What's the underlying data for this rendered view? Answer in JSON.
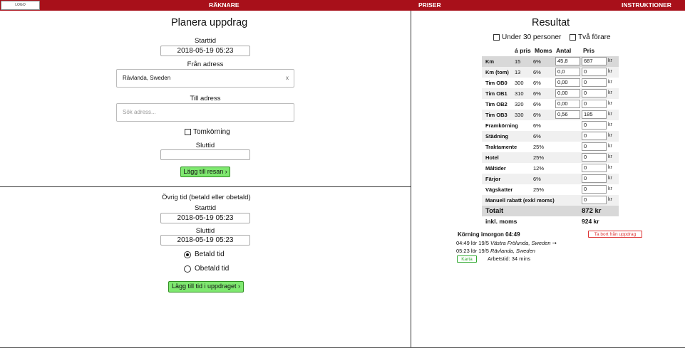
{
  "nav": {
    "logo": "LOGO",
    "raknare": "RÄKNARE",
    "priser": "PRISER",
    "instruktioner": "INSTRUKTIONER"
  },
  "plan": {
    "title": "Planera uppdrag",
    "starttid_label": "Starttid",
    "starttid_value": "2018-05-19 05:23",
    "fran_label": "Från adress",
    "fran_value": "Rävlanda, Sweden",
    "fran_clear": "x",
    "till_label": "Till adress",
    "till_placeholder": "Sök adress...",
    "tomkorning": "Tomkörning",
    "sluttid_label": "Sluttid",
    "sluttid_value": "",
    "add_button": "Lägg till resan ›"
  },
  "ovrig": {
    "title": "Övrig tid (betald eller obetald)",
    "starttid_label": "Starttid",
    "starttid_value": "2018-05-19 05:23",
    "sluttid_label": "Sluttid",
    "sluttid_value": "2018-05-19 05:23",
    "betald": "Betald tid",
    "obetald": "Obetald tid",
    "selected": "betald",
    "add_button": "Lägg till tid i uppdraget ›"
  },
  "result": {
    "title": "Resultat",
    "under30": "Under 30 personer",
    "tva_forare": "Två förare",
    "headers": {
      "apris": "á pris",
      "moms": "Moms",
      "antal": "Antal",
      "pris": "Pris"
    },
    "currency": "kr",
    "rows": [
      {
        "name": "Km",
        "apris": "15",
        "moms": "6%",
        "antal": "45,8",
        "pris": "687"
      },
      {
        "name": "Km (tom)",
        "apris": "13",
        "moms": "6%",
        "antal": "0,0",
        "pris": "0"
      },
      {
        "name": "Tim OB0",
        "apris": "300",
        "moms": "6%",
        "antal": "0,00",
        "pris": "0"
      },
      {
        "name": "Tim OB1",
        "apris": "310",
        "moms": "6%",
        "antal": "0,00",
        "pris": "0"
      },
      {
        "name": "Tim OB2",
        "apris": "320",
        "moms": "6%",
        "antal": "0,00",
        "pris": "0"
      },
      {
        "name": "Tim OB3",
        "apris": "330",
        "moms": "6%",
        "antal": "0,56",
        "pris": "185"
      },
      {
        "name": "Framkörning",
        "apris": "",
        "moms": "6%",
        "antal": null,
        "pris": "0"
      },
      {
        "name": "Städning",
        "apris": "",
        "moms": "6%",
        "antal": null,
        "pris": "0"
      },
      {
        "name": "Traktamente",
        "apris": "",
        "moms": "25%",
        "antal": null,
        "pris": "0"
      },
      {
        "name": "Hotel",
        "apris": "",
        "moms": "25%",
        "antal": null,
        "pris": "0"
      },
      {
        "name": "Måltider",
        "apris": "",
        "moms": "12%",
        "antal": null,
        "pris": "0"
      },
      {
        "name": "Färjor",
        "apris": "",
        "moms": "6%",
        "antal": null,
        "pris": "0"
      },
      {
        "name": "Vägskatter",
        "apris": "",
        "moms": "25%",
        "antal": null,
        "pris": "0"
      },
      {
        "name": "Manuell rabatt (exkl moms)",
        "apris": "",
        "moms": "",
        "antal": null,
        "pris": "0"
      }
    ],
    "totalt_label": "Totalt",
    "totalt_value": "872 kr",
    "inkl_label": "inkl. moms",
    "inkl_value": "924 kr",
    "trip": {
      "heading": "Körning imorgon 04:49",
      "remove": "Ta bort från uppdrag",
      "line1_time": "04:49 lör 19/5",
      "line1_place": "Västra Frölunda, Sweden",
      "line1_arrow": "➞",
      "line2_time": "05:23 lör 19/5",
      "line2_place": "Rävlanda, Sweden",
      "karta": "Karta",
      "arbetstid": "Arbetstid: 34 mins"
    }
  }
}
